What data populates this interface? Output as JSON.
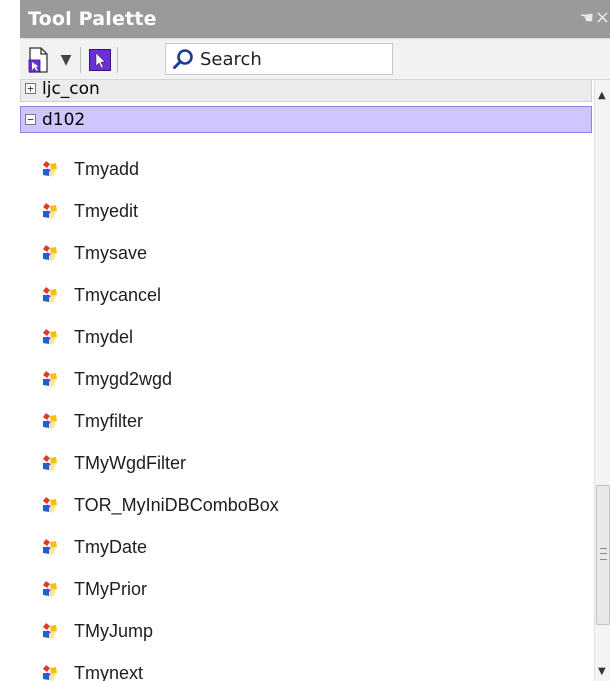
{
  "window": {
    "title": "Tool Palette"
  },
  "toolbar": {
    "search_placeholder": "Search"
  },
  "categories": [
    {
      "label": "ljc_con",
      "expanded": false
    },
    {
      "label": "d102",
      "expanded": true
    }
  ],
  "items": [
    "Tmyadd",
    "Tmyedit",
    "Tmysave",
    "Tmycancel",
    "Tmydel",
    "Tmygd2wgd",
    "Tmyfilter",
    "TMyWgdFilter",
    "TOR_MyIniDBComboBox",
    "TmyDate",
    "TMyPrior",
    "TMyJump",
    "Tmynext"
  ],
  "colors": {
    "titlebar_bg": "#9a9a9a",
    "selected_category_bg": "#cfc6ff",
    "selected_category_border": "#8f85e0",
    "accent": "#6a2fd6"
  },
  "icons": {
    "new": "new-package-icon",
    "dropdown": "chevron-down-icon",
    "pointer": "pointer-tool-icon",
    "search": "search-icon",
    "component": "component-icon",
    "pin": "pin-icon",
    "close": "close-icon"
  }
}
